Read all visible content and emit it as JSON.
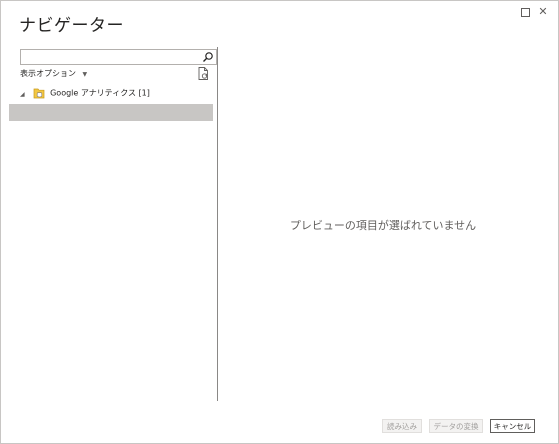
{
  "dialog": {
    "title": "ナビゲーター"
  },
  "window_controls": {
    "maximize_icon": "square-icon",
    "close_symbol": "✕"
  },
  "navigator": {
    "search": {
      "value": "",
      "placeholder": ""
    },
    "options_label": "表示オプション",
    "tree": [
      {
        "label": "Google アナリティクス [1]",
        "expanded": true,
        "icon": "folder-database-icon"
      }
    ]
  },
  "preview": {
    "empty_message": "プレビューの項目が選ばれていません"
  },
  "footer": {
    "load_label": "読み込み",
    "transform_label": "データの変換",
    "cancel_label": "キャンセル"
  },
  "colors": {
    "selection": "#c8c6c4",
    "divider": "#8a8886",
    "disabled_text": "#a19f9d"
  }
}
